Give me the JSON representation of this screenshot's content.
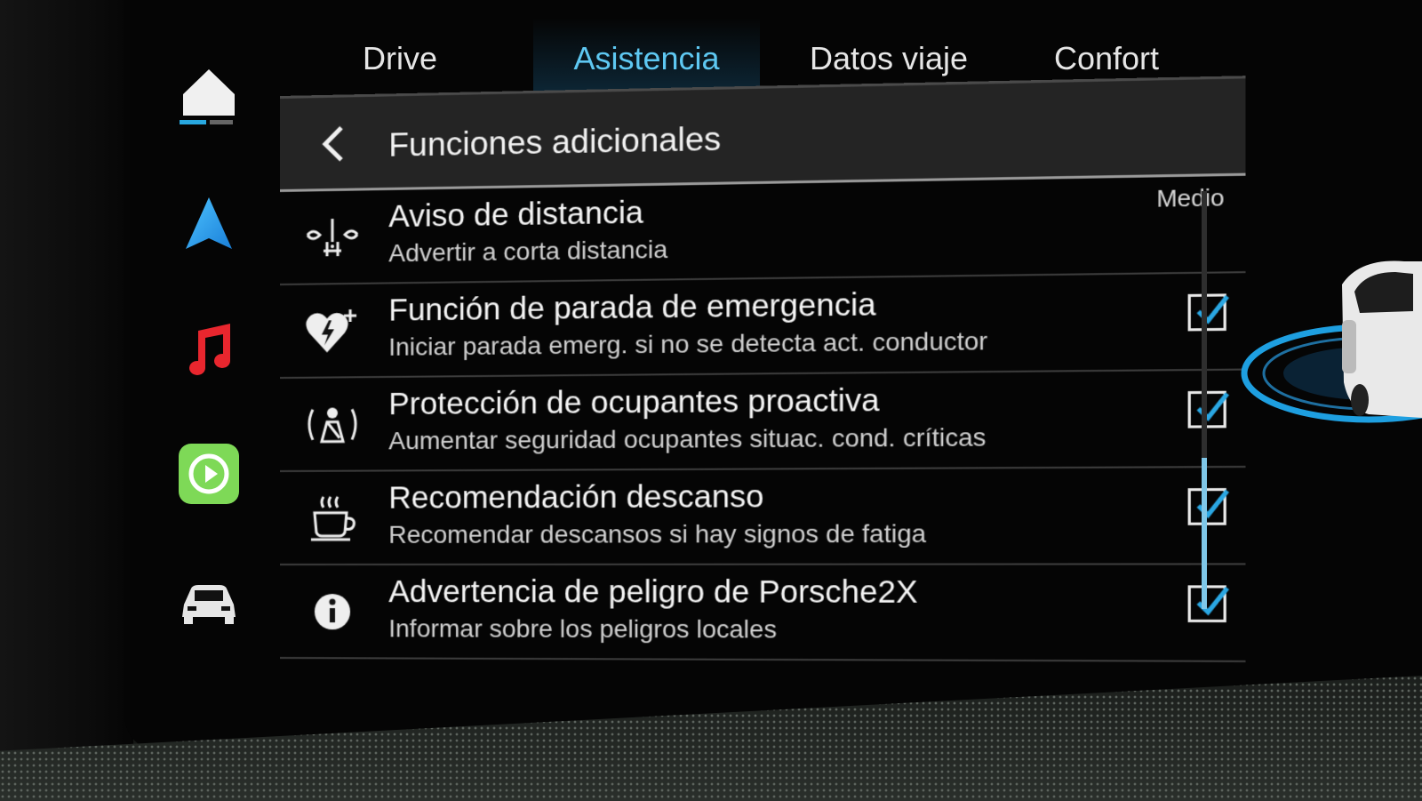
{
  "tabs": [
    {
      "label": "Drive",
      "active": false
    },
    {
      "label": "Asistencia",
      "active": true
    },
    {
      "label": "Datos viaje",
      "active": false
    },
    {
      "label": "Confort",
      "active": false
    }
  ],
  "sidebar": {
    "items": [
      {
        "icon": "home-icon"
      },
      {
        "icon": "navigation-icon"
      },
      {
        "icon": "music-icon"
      },
      {
        "icon": "carplay-icon"
      },
      {
        "icon": "car-icon"
      }
    ]
  },
  "header": {
    "title": "Funciones adicionales",
    "back_icon": "chevron-left-icon"
  },
  "rows": [
    {
      "icon": "distance-warning-icon",
      "title": "Aviso de distancia",
      "subtitle": "Advertir a corta distancia",
      "value": "Medio",
      "checked": null
    },
    {
      "icon": "emergency-heart-icon",
      "title": "Función de parada de emergencia",
      "subtitle": "Iniciar parada emerg. si no se detecta act. conductor",
      "value": "",
      "checked": true
    },
    {
      "icon": "occupant-protection-icon",
      "title": "Protección de ocupantes proactiva",
      "subtitle": "Aumentar seguridad ocupantes situac. cond. críticas",
      "value": "",
      "checked": true
    },
    {
      "icon": "coffee-cup-icon",
      "title": "Recomendación descanso",
      "subtitle": "Recomendar descansos si hay signos de fatiga",
      "value": "",
      "checked": true
    },
    {
      "icon": "info-icon",
      "title": "Advertencia de peligro de Porsche2X",
      "subtitle": "Informar sobre los peligros locales",
      "value": "",
      "checked": true
    }
  ],
  "colors": {
    "accent": "#2aa7e3",
    "accent_text": "#5ec8f2",
    "music_red": "#e8262e",
    "carplay_green": "#7ed957"
  }
}
